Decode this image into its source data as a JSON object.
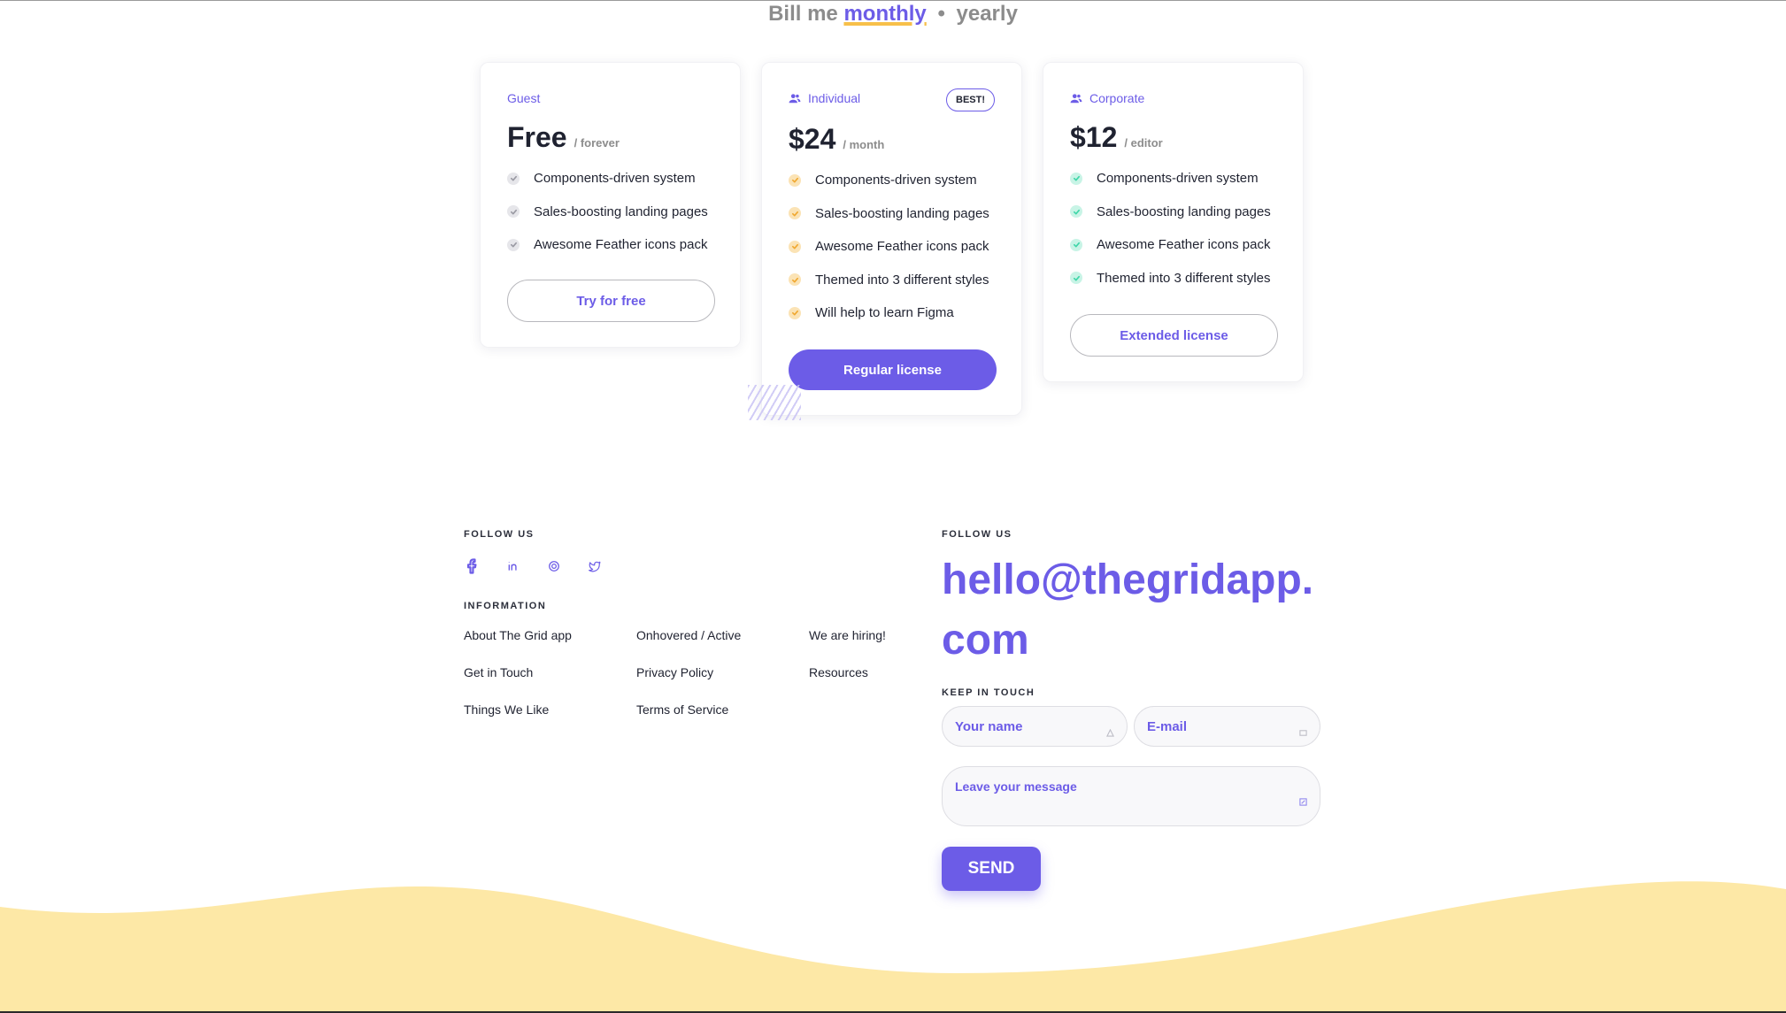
{
  "billing": {
    "prefix": "Bill me",
    "monthly": "monthly",
    "separator": "•",
    "yearly": "yearly"
  },
  "plans": [
    {
      "name": "Guest",
      "price": "Free",
      "period": "/ forever",
      "check_color": "#9a9aa3",
      "features": [
        "Components-driven system",
        "Sales-boosting landing pages",
        "Awesome Feather icons pack"
      ],
      "button": "Try for free"
    },
    {
      "name": "Individual",
      "badge": "BEST!",
      "price": "$24",
      "period": "/ month",
      "check_color": "#f0a830",
      "features": [
        "Components-driven system",
        "Sales-boosting landing pages",
        "Awesome Feather icons pack",
        "Themed into 3 different styles",
        "Will help to learn Figma"
      ],
      "button": "Regular license"
    },
    {
      "name": "Corporate",
      "price": "$12",
      "period": "/ editor",
      "check_color": "#3ed6a8",
      "features": [
        "Components-driven system",
        "Sales-boosting landing pages",
        "Awesome Feather icons pack",
        "Themed into 3 different styles"
      ],
      "button": "Extended license"
    }
  ],
  "footer": {
    "follow_label": "FOLLOW US",
    "social_icons": [
      "facebook-icon",
      "linkedin-icon",
      "instagram-icon",
      "twitter-icon"
    ],
    "information_label": "INFORMATION",
    "links": [
      [
        "About The Grid app",
        "Onhovered / Active",
        "We are hiring!"
      ],
      [
        "Get in Touch",
        "Privacy Policy",
        "Resources"
      ],
      [
        "Things We Like",
        "Terms of Service"
      ]
    ],
    "contact_label": "FOLLOW US",
    "email": "hello@thegridapp.com",
    "keep_in_touch_label": "KEEP IN TOUCH",
    "name_placeholder": "Your name",
    "email_placeholder": "E-mail",
    "message_placeholder": "Leave your message",
    "send_label": "SEND"
  },
  "colors": {
    "accent": "#6c5ce7",
    "underline": "#f7c04a",
    "wave": "#fde8a6"
  }
}
